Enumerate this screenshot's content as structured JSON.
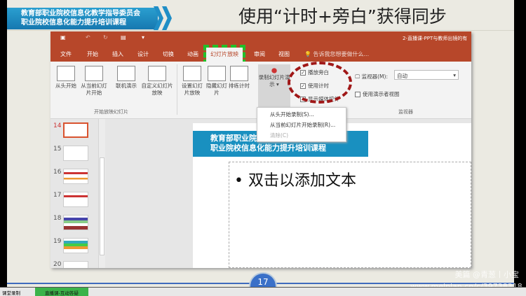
{
  "header": {
    "banner_line1": "教育部职业院校信息化教学指导委员会",
    "banner_line2": "职业院校信息化能力提升培训课程",
    "title": "使用“计时+旁白”获得同步"
  },
  "ppt": {
    "window_title": "2-直播课-PPT与教师出镜的有",
    "tabs": [
      "文件",
      "开始",
      "插入",
      "设计",
      "切换",
      "动画",
      "幻灯片放映",
      "审阅",
      "视图"
    ],
    "active_tab": "幻灯片放映",
    "tell_me": "告诉我您想要做什么...",
    "ribbon": {
      "from_beginning": "从头开始",
      "from_current": "从当前幻灯片开始",
      "online": "联机演示",
      "custom": "自定义幻灯片放映",
      "group1": "开始放映幻灯片",
      "setup": "设置幻灯片放映",
      "hide": "隐藏幻灯片",
      "rehearse": "排练计时",
      "record": "录制幻灯片演示",
      "play_narration": "播放旁白",
      "use_timings": "使用计时",
      "show_media": "显示媒体控件",
      "monitor_label": "监视器(M):",
      "monitor_value": "自动",
      "presenter_view": "使用演示者视图",
      "group_monitor": "监视器"
    },
    "record_menu": [
      "从头开始录制(S)...",
      "从当前幻灯片开始录制(R)...",
      "清除(C)"
    ],
    "thumbs": [
      "14",
      "15",
      "16",
      "17",
      "18",
      "19",
      "20"
    ],
    "slide_banner1": "教育部职业院校信息化教学指导委员会",
    "slide_banner2": "职业院校信息化能力提升培训课程",
    "placeholder": "双击以添加文本"
  },
  "page_number": "17",
  "taskbar": [
    "课堂录制",
    "直播课-互动答疑"
  ],
  "watermark": {
    "line1": "美篇 @青葱丨小宝",
    "line2": "www.meipian.cn/c/39738318"
  },
  "colors": {
    "ppt_red": "#b7472a",
    "banner_blue": "#1990c0",
    "highlight_green": "#22c02a",
    "circle_red": "#a01818"
  }
}
